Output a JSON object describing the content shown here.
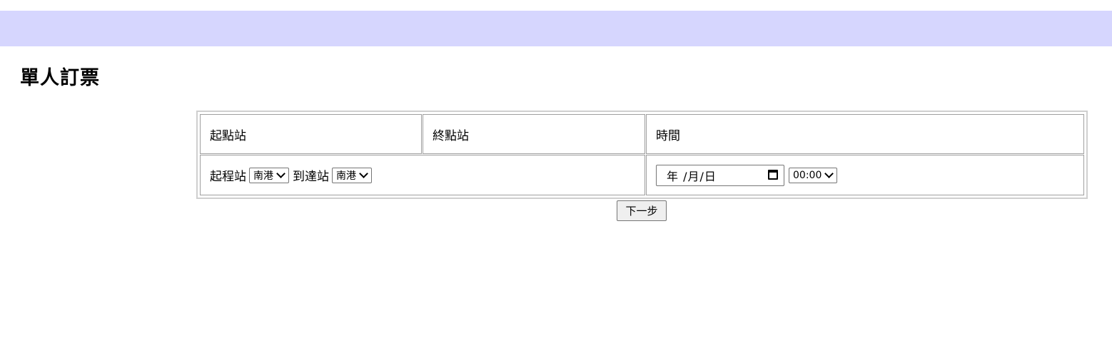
{
  "page": {
    "title": "單人訂票",
    "banner_color": "#d6d6fe"
  },
  "table": {
    "headers": {
      "origin": "起點站",
      "destination": "終點站",
      "time": "時間"
    },
    "stations": {
      "from_label": "起程站",
      "from_value": "南港",
      "to_label": "到達站",
      "to_value": "南港"
    },
    "datetime": {
      "date_placeholder": "年 /月/日",
      "time_value": "00:00"
    }
  },
  "actions": {
    "next_label": "下一步"
  },
  "icons": {
    "dropdown": "chevron-down-icon",
    "calendar": "calendar-icon"
  }
}
